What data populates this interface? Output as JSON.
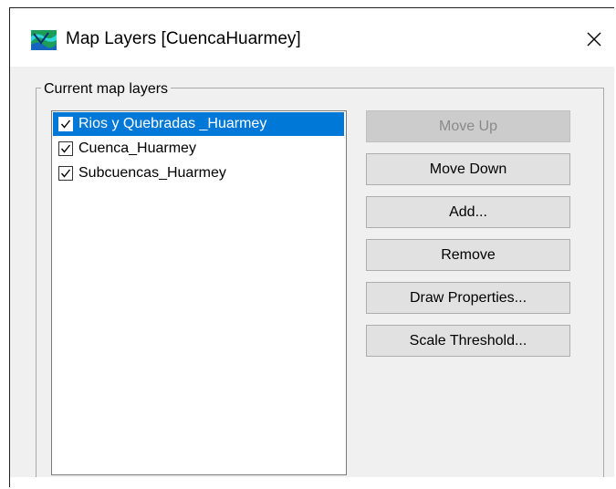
{
  "window": {
    "title": "Map Layers [CuencaHuarmey]",
    "app_icon": "map-layers-icon",
    "close_icon": "close-icon"
  },
  "group": {
    "legend": "Current map layers"
  },
  "layers": [
    {
      "label": "Rios y Quebradas _Huarmey",
      "checked": true,
      "selected": true
    },
    {
      "label": "Cuenca_Huarmey",
      "checked": true,
      "selected": false
    },
    {
      "label": "Subcuencas_Huarmey",
      "checked": true,
      "selected": false
    }
  ],
  "buttons": {
    "move_up": "Move Up",
    "move_down": "Move Down",
    "add": "Add...",
    "remove": "Remove",
    "draw_properties": "Draw Properties...",
    "scale_threshold": "Scale Threshold..."
  },
  "colors": {
    "selection": "#0078d7",
    "dialog_bg": "#f0f0f0"
  }
}
